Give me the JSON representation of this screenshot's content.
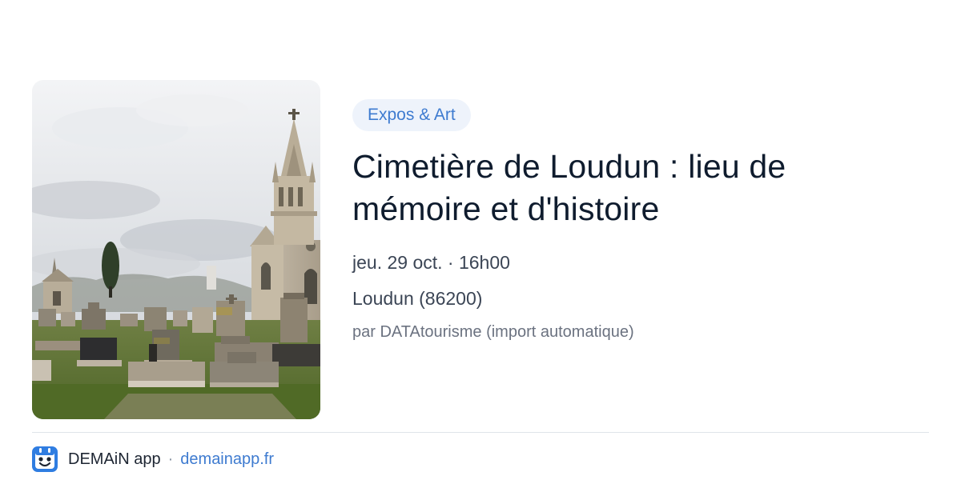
{
  "image": {
    "subject": "cemetery-church-photo"
  },
  "category": "Expos & Art",
  "event": {
    "title": "Cimetière de Loudun : lieu de mémoire et d'histoire",
    "date": "jeu. 29 oct. · 16h00",
    "location": "Loudun (86200)",
    "source": "par DATAtourisme (import automatique)"
  },
  "footer": {
    "app_name": "DEMAiN app",
    "separator": "·",
    "url": "demainapp.fr",
    "logo_icon": "demain-logo-icon"
  },
  "colors": {
    "accent": "#3e7bd0",
    "pill_bg": "#eef3fb",
    "title": "#0f1c2e",
    "meta": "#3b4555",
    "muted": "#6b7280"
  }
}
